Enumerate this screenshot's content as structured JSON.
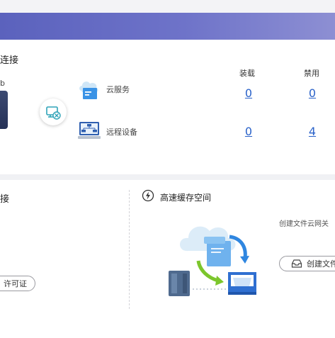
{
  "top_section": {
    "title": "连接",
    "left_letter": "b",
    "col_headers": [
      "装载",
      "禁用"
    ],
    "rows": [
      {
        "label": "云服务",
        "mounted": "0",
        "disabled": "0",
        "icon": "cloud-service-icon"
      },
      {
        "label": "远程设备",
        "mounted": "0",
        "disabled": "4",
        "icon": "remote-device-icon"
      }
    ]
  },
  "bottom_left": {
    "title": "接",
    "license_button": "许可证"
  },
  "cache_section": {
    "title": "高速缓存空间",
    "description": "创建文件云网关",
    "create_button": "创建文件"
  },
  "colors": {
    "banner": "#5b62bd",
    "link": "#2a62c9",
    "arrow_green": "#7cc62c",
    "arrow_blue": "#2f86e0"
  }
}
